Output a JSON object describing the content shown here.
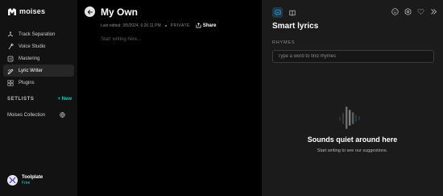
{
  "app": {
    "logo_text": "moises"
  },
  "sidebar": {
    "items": [
      {
        "label": "Track Separation",
        "icon": "track-separation-icon"
      },
      {
        "label": "Voice Studio",
        "icon": "voice-studio-icon"
      },
      {
        "label": "Mastering",
        "icon": "mastering-icon"
      },
      {
        "label": "Lyric Writer",
        "icon": "lyric-writer-icon",
        "active": true
      },
      {
        "label": "Plugins",
        "icon": "plugins-icon"
      }
    ],
    "setlists_title": "SETLISTS",
    "new_label": "+ New",
    "collection": "Moises Collection",
    "user": {
      "name": "Toolplate",
      "plan": "Free"
    }
  },
  "editor": {
    "title": "My Own",
    "last_edited": "Last edited: 3/5/2024, 6:26:11 PM",
    "visibility": "PRIVATE",
    "share_label": "Share",
    "placeholder": "Start writing here..."
  },
  "panel": {
    "title": "Smart lyrics",
    "section_label": "RHYMES",
    "input_placeholder": "Type a word to find rhymes",
    "empty_title": "Sounds quiet around here",
    "empty_subtitle": "Start writing to see our suggestions."
  },
  "colors": {
    "accent": "#0fd2c3",
    "sidebar_bg": "#121212",
    "panel_bg": "#1b1b1b"
  }
}
